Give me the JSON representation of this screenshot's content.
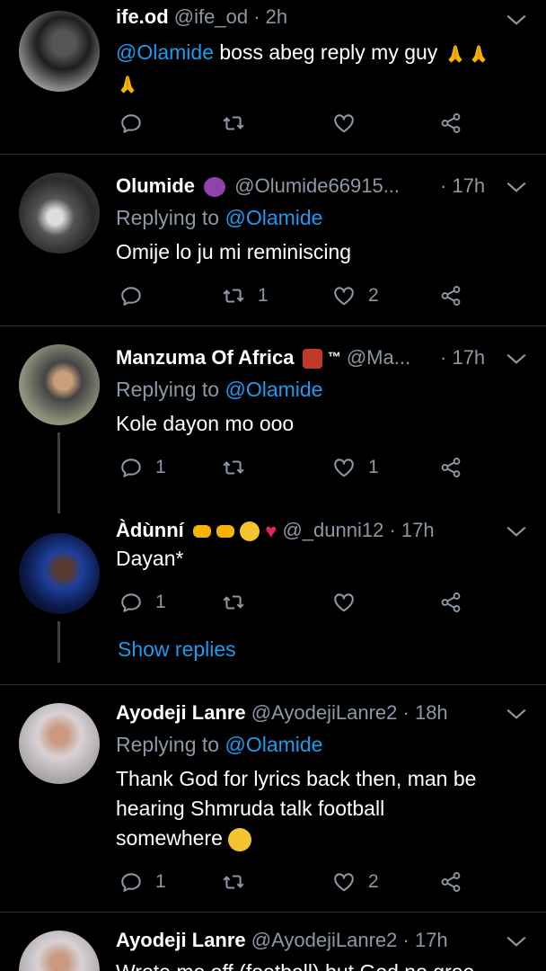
{
  "tweets": [
    {
      "name": "ife.od",
      "handle": "@ife_od",
      "time": "2h",
      "replying": "",
      "text_mention": "@Olamide",
      "text": "boss abeg reply my guy",
      "replies": "",
      "retweets": "",
      "likes": "",
      "avatar_color": "#2b2b2b"
    },
    {
      "name": "Olumide",
      "handle": "@Olumide66915...",
      "time": "17h",
      "replying_label": "Replying to",
      "replying": "@Olamide",
      "text": "Omije lo ju mi reminiscing",
      "replies": "",
      "retweets": "1",
      "likes": "2",
      "avatar_color": "#3a3a3a"
    },
    {
      "name": "Manzuma Of Africa",
      "name_suffix": "™",
      "handle": "@Ma...",
      "time": "17h",
      "replying_label": "Replying to",
      "replying": "@Olamide",
      "text": "Kole dayon mo ooo",
      "replies": "1",
      "retweets": "",
      "likes": "1",
      "avatar_color": "#6f6f5a"
    },
    {
      "name": "Àdùnní",
      "handle": "@_dunni12",
      "time": "17h",
      "text": "Dayan*",
      "replies": "1",
      "retweets": "",
      "likes": "",
      "avatar_color": "#1a3a8a"
    },
    {
      "name": "Ayodeji Lanre",
      "handle": "@AyodejiLanre2",
      "time": "18h",
      "replying_label": "Replying to",
      "replying": "@Olamide",
      "text_lines": [
        "Thank God for lyrics back then, man be",
        "hearing Shmruda talk football",
        "somewhere"
      ],
      "replies": "1",
      "retweets": "",
      "likes": "2",
      "avatar_color": "#b9b4b8"
    },
    {
      "name": "Ayodeji Lanre",
      "handle": "@AyodejiLanre2",
      "time": "17h",
      "text": "Wrote me off (football) but God no gree",
      "avatar_color": "#b9b4b8"
    }
  ],
  "show_replies": "Show replies",
  "colors": {
    "background": "#000000",
    "accent": "#1d9bf0",
    "secondary": "#8b98a5",
    "separator": "#2f3336"
  },
  "icons": [
    "reply-icon",
    "retweet-icon",
    "like-icon",
    "share-icon",
    "chevron-down-icon"
  ]
}
